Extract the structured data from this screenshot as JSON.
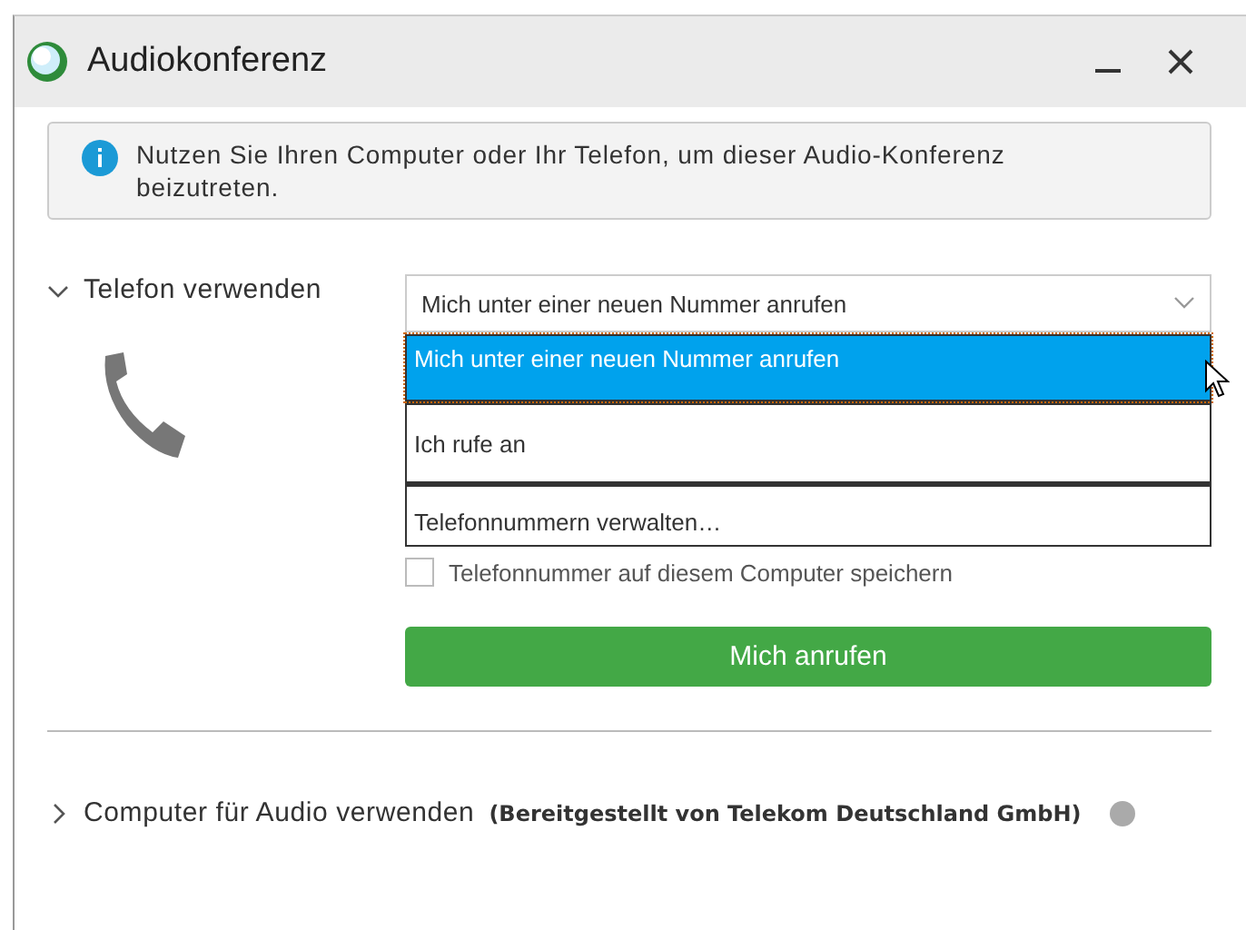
{
  "window": {
    "title": "Audiokonferenz"
  },
  "info": {
    "text": "Nutzen Sie Ihren Computer oder Ihr Telefon, um dieser Audio-Konferenz beizutreten."
  },
  "phone_section": {
    "label": "Telefon verwenden",
    "expanded": true,
    "select": {
      "value": "Mich unter einer neuen Nummer anrufen",
      "open": true,
      "options": [
        {
          "label": "Mich unter einer neuen Nummer anrufen",
          "selected": true
        },
        {
          "label": "Ich rufe an",
          "selected": false
        },
        {
          "label": "Telefonnummern verwalten…",
          "selected": false
        }
      ]
    },
    "save_checkbox": {
      "label": "Telefonnummer auf diesem Computer speichern",
      "checked": false
    },
    "call_button": "Mich anrufen"
  },
  "computer_section": {
    "label": "Computer für Audio verwenden",
    "expanded": false,
    "provider": "(Bereitgestellt von Telekom Deutschland GmbH)"
  }
}
